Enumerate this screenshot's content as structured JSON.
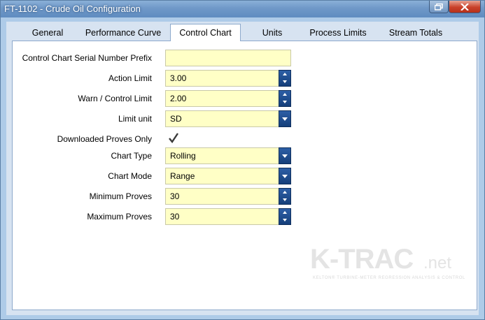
{
  "window": {
    "title": "FT-1102 - Crude Oil Configuration"
  },
  "tabs": [
    {
      "label": "General",
      "active": false
    },
    {
      "label": "Performance Curve",
      "active": false
    },
    {
      "label": "Control Chart",
      "active": true
    },
    {
      "label": "Units",
      "active": false
    },
    {
      "label": "Process Limits",
      "active": false
    },
    {
      "label": "Stream Totals",
      "active": false
    }
  ],
  "form": {
    "serial_prefix": {
      "label": "Control Chart Serial Number Prefix",
      "value": ""
    },
    "action_limit": {
      "label": "Action Limit",
      "value": "3.00"
    },
    "warn_limit": {
      "label": "Warn / Control Limit",
      "value": "2.00"
    },
    "limit_unit": {
      "label": "Limit unit",
      "value": "SD"
    },
    "downloaded_only": {
      "label": "Downloaded Proves Only",
      "checked": true
    },
    "chart_type": {
      "label": "Chart Type",
      "value": "Rolling"
    },
    "chart_mode": {
      "label": "Chart Mode",
      "value": "Range"
    },
    "min_proves": {
      "label": "Minimum Proves",
      "value": "30"
    },
    "max_proves": {
      "label": "Maximum Proves",
      "value": "30"
    }
  },
  "logo": {
    "main": "K-TRAC",
    "suffix": ".net",
    "tagline": "KELTON® TURBINE-METER REGRESSION ANALYSIS & CONTROL"
  },
  "colors": {
    "field_bg": "#ffffc6",
    "accent": "#1f4f91",
    "titlebar": "#6f98c8"
  },
  "icons": [
    "restore-icon",
    "close-icon",
    "spin-up-icon",
    "spin-down-icon",
    "dropdown-arrow-icon",
    "checkmark-icon"
  ]
}
